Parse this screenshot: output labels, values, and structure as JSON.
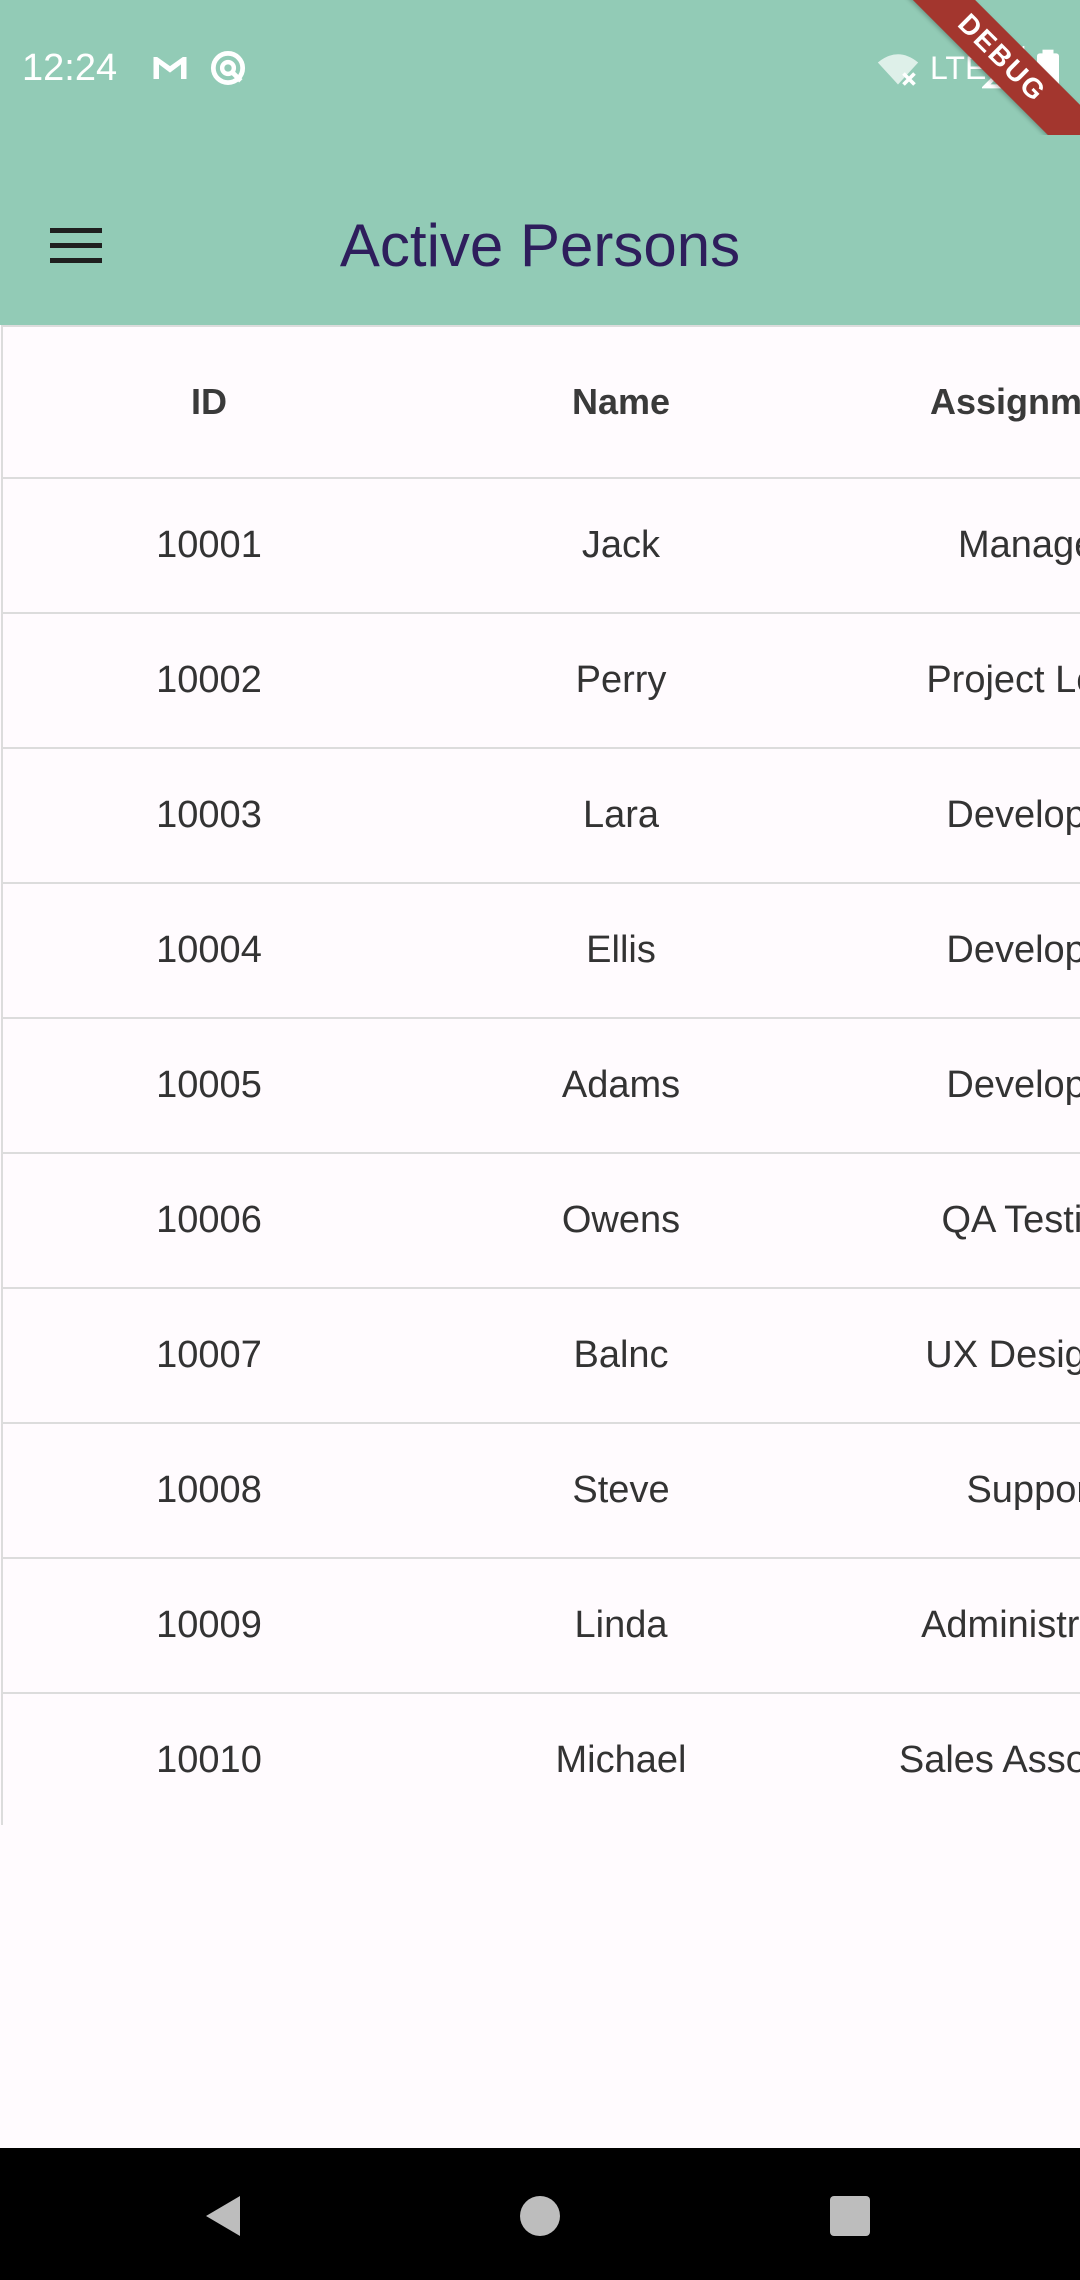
{
  "status_bar": {
    "time": "12:24",
    "network": "LTE",
    "icons": [
      "gmail-icon",
      "sync-icon",
      "wifi-off-icon",
      "signal-icon",
      "battery-icon"
    ]
  },
  "debug_banner": "DEBUG",
  "app_bar": {
    "title": "Active Persons",
    "menu_icon": "hamburger-menu-icon"
  },
  "table": {
    "headers": {
      "id": "ID",
      "name": "Name",
      "assignment": "Assignment"
    },
    "rows": [
      {
        "id": "10001",
        "name": "Jack",
        "assignment": "Manager"
      },
      {
        "id": "10002",
        "name": "Perry",
        "assignment": "Project Lead"
      },
      {
        "id": "10003",
        "name": "Lara",
        "assignment": "Developer"
      },
      {
        "id": "10004",
        "name": "Ellis",
        "assignment": "Developer"
      },
      {
        "id": "10005",
        "name": "Adams",
        "assignment": "Developer"
      },
      {
        "id": "10006",
        "name": "Owens",
        "assignment": "QA Testing"
      },
      {
        "id": "10007",
        "name": "Balnc",
        "assignment": "UX Designer"
      },
      {
        "id": "10008",
        "name": "Steve",
        "assignment": "Support"
      },
      {
        "id": "10009",
        "name": "Linda",
        "assignment": "Administrator"
      },
      {
        "id": "10010",
        "name": "Michael",
        "assignment": "Sales Associate"
      }
    ]
  },
  "nav_bar": {
    "back_icon": "back-triangle-icon",
    "home_icon": "home-circle-icon",
    "recents_icon": "recents-square-icon"
  },
  "colors": {
    "app_bar": "#92CBB6",
    "title": "#2E1E5C",
    "background": "#FFFBFE",
    "divider": "#DCDCDC",
    "debug_banner": "#A3362E"
  }
}
